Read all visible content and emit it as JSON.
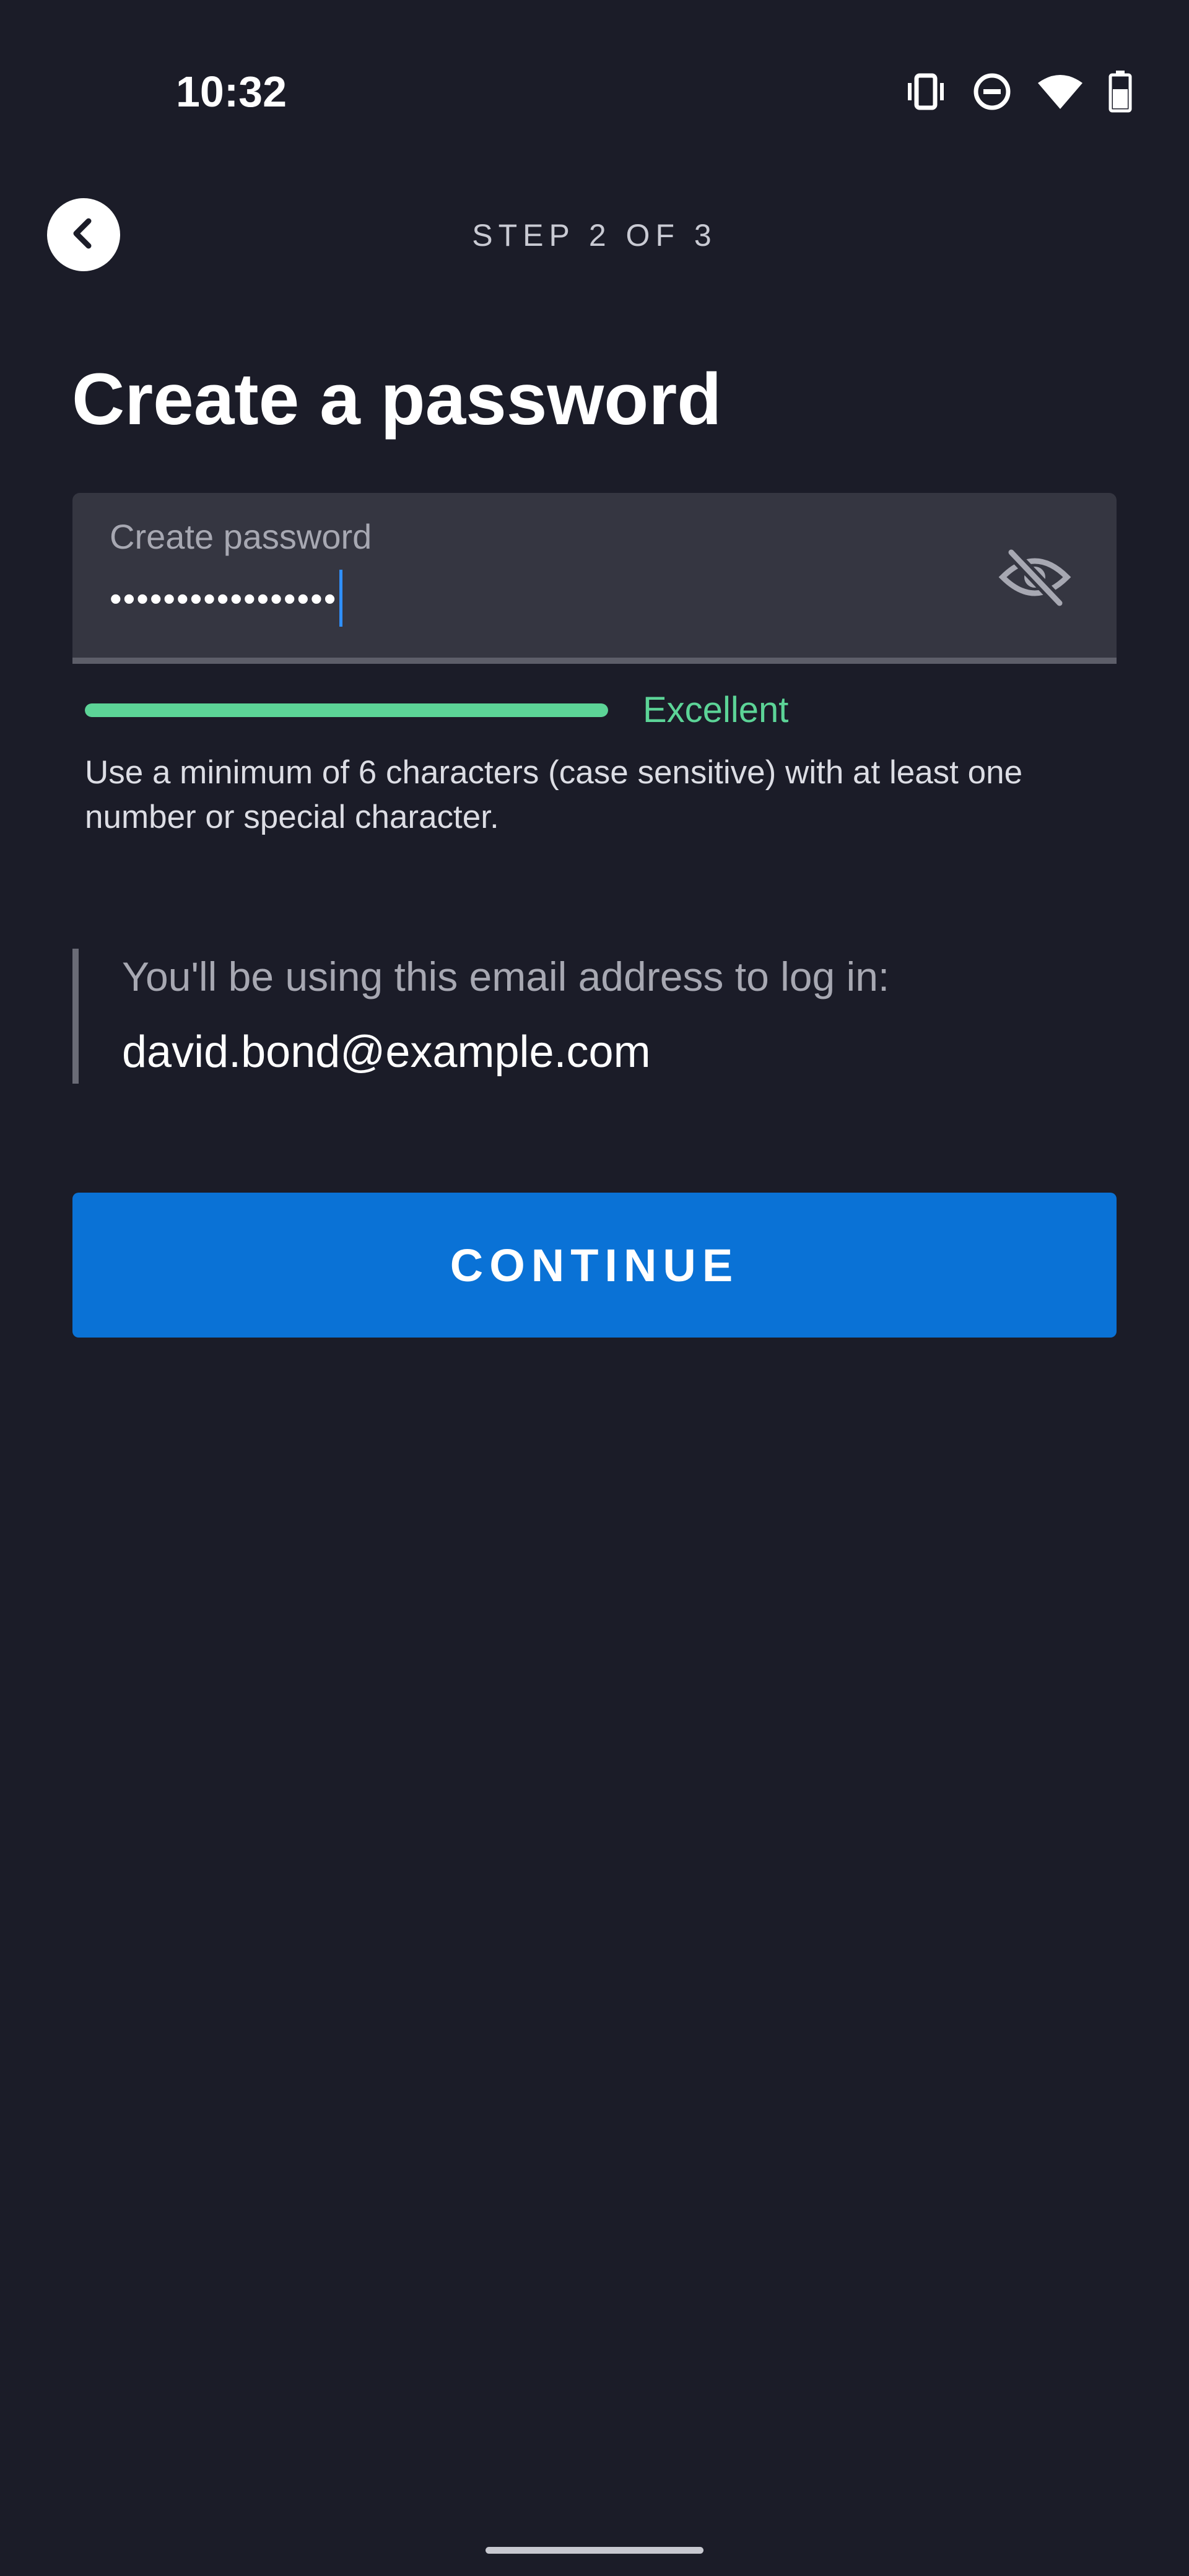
{
  "status_bar": {
    "time": "10:32",
    "icons": [
      "vibrate-icon",
      "do-not-disturb-icon",
      "wifi-icon",
      "battery-icon"
    ]
  },
  "nav": {
    "back_icon": "chevron-left-icon",
    "step": "STEP 2 OF 3"
  },
  "page": {
    "title": "Create a password"
  },
  "password_field": {
    "label": "Create password",
    "masked_value": "•••••••••••••••••",
    "visibility_icon": "eye-off-icon"
  },
  "strength": {
    "label": "Excellent",
    "level": 1.0,
    "color": "#5cd497"
  },
  "hint": "Use a minimum of 6 characters (case sensitive) with at least one number or special character.",
  "email": {
    "caption": "You'll be using this email address to log in:",
    "value": "david.bond@example.com"
  },
  "actions": {
    "continue_label": "CONTINUE"
  },
  "colors": {
    "background": "#1b1c28",
    "accent": "#0a72d6",
    "field_bg": "#353641"
  }
}
